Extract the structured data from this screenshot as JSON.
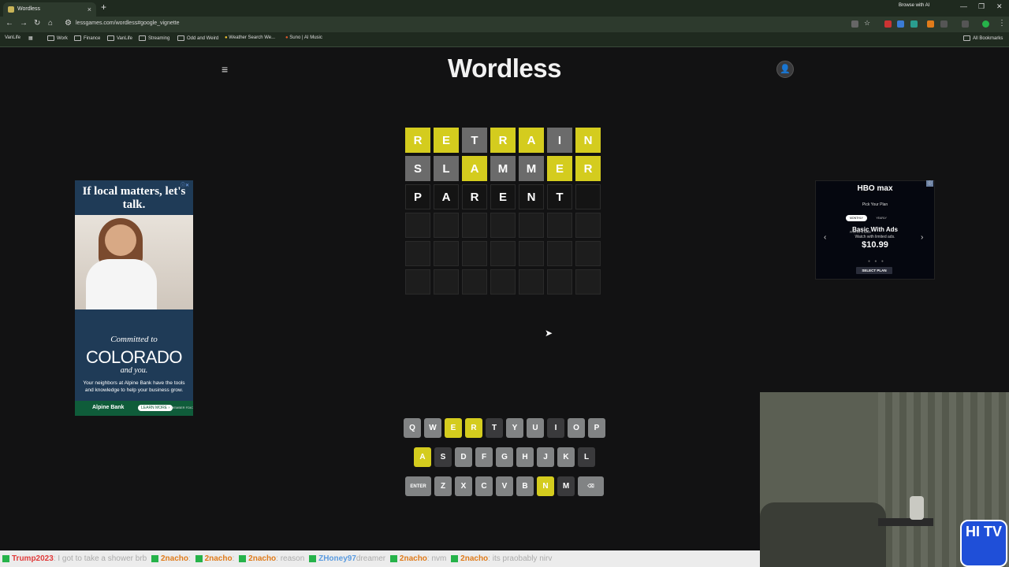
{
  "browser": {
    "tab_title": "Wordless",
    "url": "lessgames.com/wordless#google_vignette",
    "browse_ai": "Browse with AI",
    "bookmarks": [
      "VanLife",
      "Work",
      "Finance",
      "VanLife",
      "Streaming",
      "Odd and Weird",
      "Weather Search We...",
      "Suno | AI Music"
    ],
    "all_bookmarks": "All Bookmarks"
  },
  "page": {
    "title": "Wordless",
    "menu_icon": "hamburger-icon",
    "user_icon": "user-icon"
  },
  "board": {
    "rows": [
      [
        {
          "l": "R",
          "s": "y"
        },
        {
          "l": "E",
          "s": "y"
        },
        {
          "l": "T",
          "s": "g"
        },
        {
          "l": "R",
          "s": "y"
        },
        {
          "l": "A",
          "s": "y"
        },
        {
          "l": "I",
          "s": "g"
        },
        {
          "l": "N",
          "s": "y"
        }
      ],
      [
        {
          "l": "S",
          "s": "g"
        },
        {
          "l": "L",
          "s": "g"
        },
        {
          "l": "A",
          "s": "y"
        },
        {
          "l": "M",
          "s": "g"
        },
        {
          "l": "M",
          "s": "g"
        },
        {
          "l": "E",
          "s": "y"
        },
        {
          "l": "R",
          "s": "y"
        }
      ],
      [
        {
          "l": "P",
          "s": "t"
        },
        {
          "l": "A",
          "s": "t"
        },
        {
          "l": "R",
          "s": "t"
        },
        {
          "l": "E",
          "s": "t"
        },
        {
          "l": "N",
          "s": "t"
        },
        {
          "l": "T",
          "s": "t"
        },
        {
          "l": "",
          "s": "t"
        }
      ],
      [
        {
          "l": "",
          "s": "e"
        },
        {
          "l": "",
          "s": "e"
        },
        {
          "l": "",
          "s": "e"
        },
        {
          "l": "",
          "s": "e"
        },
        {
          "l": "",
          "s": "e"
        },
        {
          "l": "",
          "s": "e"
        },
        {
          "l": "",
          "s": "e"
        }
      ],
      [
        {
          "l": "",
          "s": "e"
        },
        {
          "l": "",
          "s": "e"
        },
        {
          "l": "",
          "s": "e"
        },
        {
          "l": "",
          "s": "e"
        },
        {
          "l": "",
          "s": "e"
        },
        {
          "l": "",
          "s": "e"
        },
        {
          "l": "",
          "s": "e"
        }
      ],
      [
        {
          "l": "",
          "s": "e"
        },
        {
          "l": "",
          "s": "e"
        },
        {
          "l": "",
          "s": "e"
        },
        {
          "l": "",
          "s": "e"
        },
        {
          "l": "",
          "s": "e"
        },
        {
          "l": "",
          "s": "e"
        },
        {
          "l": "",
          "s": "e"
        }
      ]
    ]
  },
  "keyboard": {
    "rows": [
      [
        {
          "k": "Q",
          "s": "n"
        },
        {
          "k": "W",
          "s": "n"
        },
        {
          "k": "E",
          "s": "y"
        },
        {
          "k": "R",
          "s": "y"
        },
        {
          "k": "T",
          "s": "a"
        },
        {
          "k": "Y",
          "s": "n"
        },
        {
          "k": "U",
          "s": "n"
        },
        {
          "k": "I",
          "s": "a"
        },
        {
          "k": "O",
          "s": "n"
        },
        {
          "k": "P",
          "s": "n"
        }
      ],
      [
        {
          "k": "A",
          "s": "y"
        },
        {
          "k": "S",
          "s": "a"
        },
        {
          "k": "D",
          "s": "n"
        },
        {
          "k": "F",
          "s": "n"
        },
        {
          "k": "G",
          "s": "n"
        },
        {
          "k": "H",
          "s": "n"
        },
        {
          "k": "J",
          "s": "n"
        },
        {
          "k": "K",
          "s": "n"
        },
        {
          "k": "L",
          "s": "a"
        }
      ],
      [
        {
          "k": "ENTER",
          "s": "n",
          "w": true
        },
        {
          "k": "Z",
          "s": "n"
        },
        {
          "k": "X",
          "s": "n"
        },
        {
          "k": "C",
          "s": "n"
        },
        {
          "k": "V",
          "s": "n"
        },
        {
          "k": "B",
          "s": "n"
        },
        {
          "k": "N",
          "s": "y"
        },
        {
          "k": "M",
          "s": "a"
        },
        {
          "k": "⌫",
          "s": "n",
          "w": true
        }
      ]
    ]
  },
  "ad_left": {
    "headline": "If local matters, let's talk.",
    "script1": "Committed to",
    "big": "COLORADO",
    "script2": "and you.",
    "sub": "Your neighbors at Alpine Bank have the tools and knowledge to help your business grow.",
    "bank": "Alpine Bank",
    "learn": "LEARN MORE ›",
    "fdic": "MEMBER FDIC"
  },
  "ad_right": {
    "logo": "HBO max",
    "pick": "Pick Your Plan",
    "tabs": [
      "MONTHLY",
      "YEARLY",
      "PREPAY & SAVE"
    ],
    "plan": "Basic With Ads",
    "watch": "Watch with limited ads.",
    "price": "$10.99",
    "button": "SELECT PLAN"
  },
  "webcam": {
    "logo": "HI TV"
  },
  "chat": {
    "messages": [
      {
        "user": "Trump2023",
        "text": ": I got to take a shower brb"
      },
      {
        "user": "2nacho",
        "text": ":"
      },
      {
        "user": "2nacho",
        "text": ":"
      },
      {
        "user": "2nacho",
        "text": ": reason"
      },
      {
        "user": "ZHoney97",
        "text": "dreamer"
      },
      {
        "user": "2nacho",
        "text": ": nvm"
      },
      {
        "user": "2nacho",
        "text": ": its praobably nirv"
      }
    ]
  },
  "colors": {
    "present": "#d4cc1e",
    "absent": "#6b6b6b",
    "background": "#121213"
  }
}
